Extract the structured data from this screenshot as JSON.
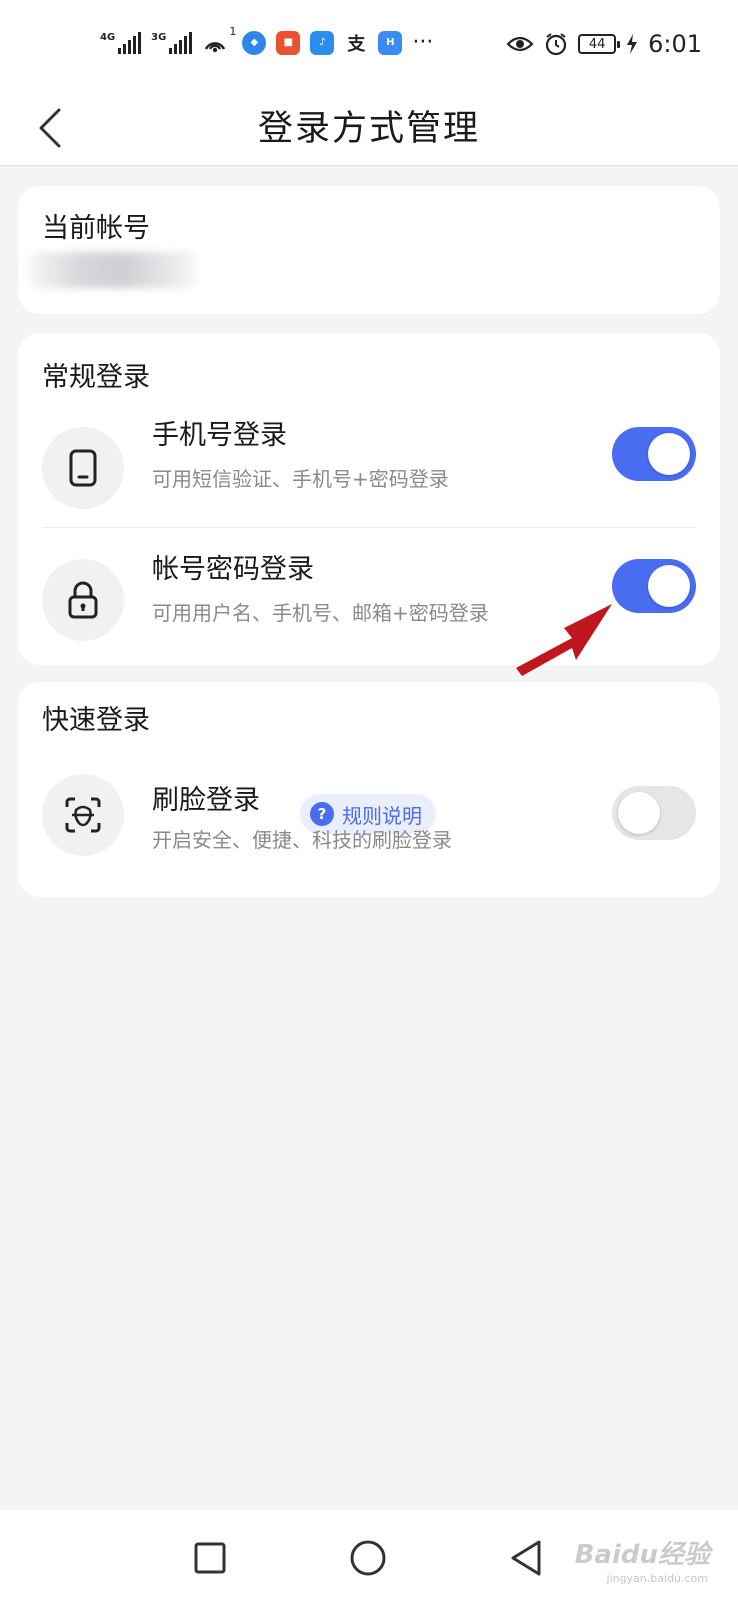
{
  "status_bar": {
    "signal1_tag": "4G",
    "signal2_tag": "3G",
    "hotspot_badge": "1",
    "more": "···",
    "battery": "44",
    "time": "6:01"
  },
  "header": {
    "title": "登录方式管理"
  },
  "account": {
    "title": "当前帐号"
  },
  "regular": {
    "title": "常规登录",
    "items": [
      {
        "title": "手机号登录",
        "subtitle": "可用短信验证、手机号+密码登录",
        "enabled": true
      },
      {
        "title": "帐号密码登录",
        "subtitle": "可用用户名、手机号、邮箱+密码登录",
        "enabled": true
      }
    ]
  },
  "quick": {
    "title": "快速登录",
    "items": [
      {
        "title": "刷脸登录",
        "subtitle": "开启安全、便捷、科技的刷脸登录",
        "rule_label": "规则说明",
        "enabled": false
      }
    ]
  },
  "nav": {
    "watermark": "Baidu经验",
    "watermark_sub": "jingyan.baidu.com"
  },
  "colors": {
    "accent": "#4a6cf1",
    "toggle_off": "#e6e6e8",
    "background": "#f4f4f5",
    "annotation_arrow": "#c0161e"
  }
}
